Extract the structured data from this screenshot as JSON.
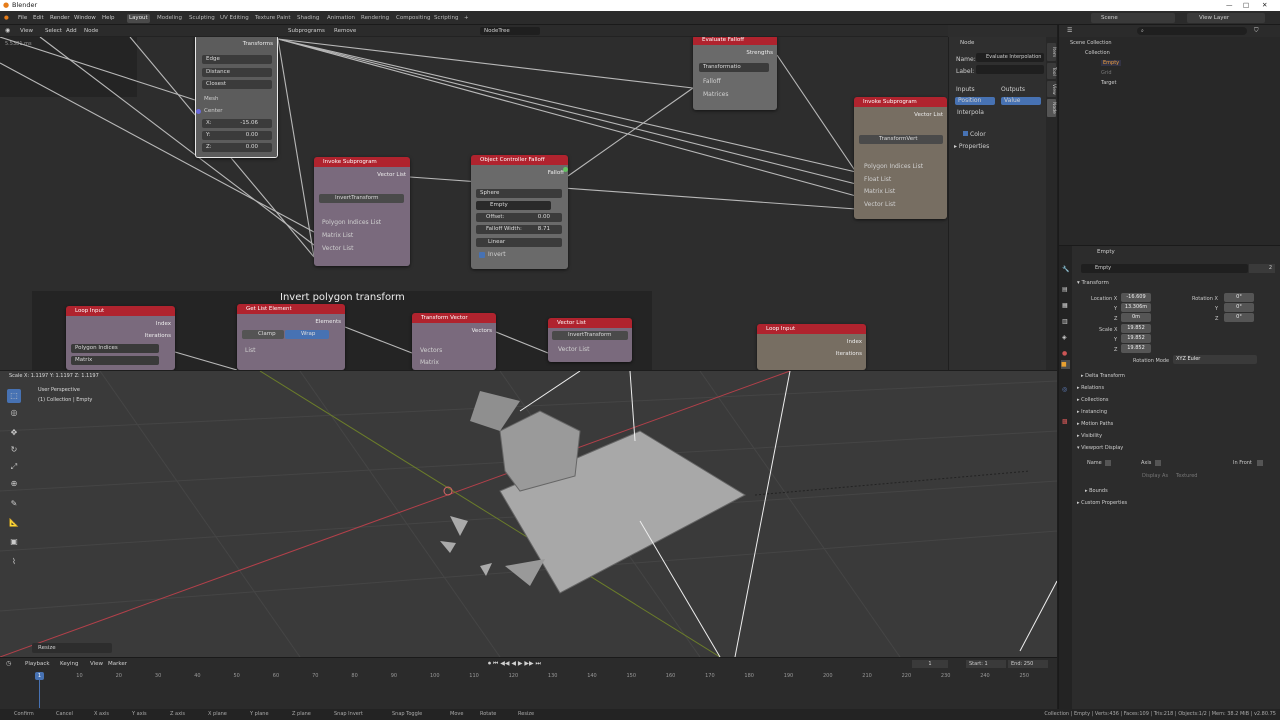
{
  "window": {
    "title": "Blender"
  },
  "topbar": {
    "menus": [
      "File",
      "Edit",
      "Render",
      "Window",
      "Help"
    ],
    "workspaces": [
      "Layout",
      "Modeling",
      "Sculpting",
      "UV Editing",
      "Texture Paint",
      "Shading",
      "Animation",
      "Rendering",
      "Compositing",
      "Scripting"
    ],
    "add_tab": "+",
    "scene": "Scene",
    "view_layer": "View Layer"
  },
  "node_editor": {
    "header_menus": [
      "View",
      "Select",
      "Add",
      "Node"
    ],
    "subprograms": "Subprograms",
    "remove": "Remove",
    "nodetree": "NodeTree",
    "stats": "5.5381 ms",
    "frame_label": "Invert polygon transform",
    "n_transforms": {
      "title": "Transforms",
      "opt1": "Edge",
      "opt2": "Distance",
      "opt3": "Closest",
      "mesh": "Mesh",
      "center": "Center",
      "x_label": "X:",
      "x": "-15.06",
      "y_label": "Y:",
      "y": "0.00",
      "z_label": "Z:",
      "z": "0.00"
    },
    "n_invoke1": {
      "title": "Invoke Subprogram",
      "vector_list": "Vector List",
      "sub": "InvertTransform",
      "in1": "Polygon Indices List",
      "in2": "Matrix List",
      "in3": "Vector List"
    },
    "n_ocf": {
      "title": "Object Controller Falloff",
      "falloff": "Falloff",
      "shape": "Sphere",
      "object": "Empty",
      "offset_label": "Offset:",
      "offset": "0.00",
      "width_label": "Falloff Width:",
      "width": "8.71",
      "interp": "Linear",
      "invert": "Invert"
    },
    "n_evalfalloff": {
      "title": "Evaluate Falloff",
      "strengths": "Strengths",
      "mode": "Transformatio",
      "falloff": "Falloff",
      "matrices": "Matrices"
    },
    "n_invoke2": {
      "title": "Invoke Subprogram",
      "vector_list": "Vector List",
      "sub": "TransformVert",
      "in1": "Polygon Indices List",
      "in2": "Float List",
      "in3": "Matrix List",
      "in4": "Vector List"
    },
    "n_loopinput": {
      "title": "Loop Input",
      "index": "Index",
      "iterations": "Iterations",
      "p1": "Polygon Indices",
      "p2": "Matrix"
    },
    "n_getlist": {
      "title": "Get List Element",
      "elements": "Elements",
      "clamp": "Clamp",
      "wrap": "Wrap",
      "list": "List"
    },
    "n_transformvec": {
      "title": "Transform Vector",
      "vectors": "Vectors",
      "in1": "Vectors",
      "in2": "Matrix"
    },
    "n_vectorlist": {
      "title": "Vector List",
      "sub": "InvertTransform",
      "out": "Vector List"
    },
    "n_loopinput2": {
      "title": "Loop Input",
      "index": "Index",
      "iterations": "Iterations"
    }
  },
  "node_sidebar": {
    "section": "Node",
    "name_label": "Name:",
    "name": "Evaluate Interpolation",
    "label_label": "Label:",
    "inputs": "Inputs",
    "outputs": "Outputs",
    "position": "Position",
    "value": "Value",
    "interp": "Interpola",
    "color": "Color",
    "properties": "Properties",
    "tabs": [
      "Item",
      "Tool",
      "View",
      "Node"
    ]
  },
  "viewport": {
    "scale_readout": "Scale X: 1.1197  Y: 1.1197  Z: 1.1197",
    "perspective": "User Perspective",
    "collection": "(1) Collection | Empty",
    "operator": "Resize"
  },
  "timeline": {
    "menus": [
      "Playback",
      "Keying",
      "View",
      "Marker"
    ],
    "current": "1",
    "start_label": "Start:",
    "start": "1",
    "end_label": "End:",
    "end": "250",
    "ticks": [
      "0",
      "10",
      "20",
      "30",
      "40",
      "50",
      "60",
      "70",
      "80",
      "90",
      "100",
      "110",
      "120",
      "130",
      "140",
      "150",
      "160",
      "170",
      "180",
      "190",
      "200",
      "210",
      "220",
      "230",
      "240",
      "250"
    ]
  },
  "statusbar": {
    "hints": [
      "Confirm",
      "Cancel",
      "X axis",
      "Y axis",
      "Z axis",
      "X plane",
      "Y plane",
      "Z plane",
      "Snap Invert",
      "Snap Toggle",
      "Move",
      "Rotate",
      "Resize"
    ],
    "stats": "Collection | Empty | Verts:436 | Faces:109 | Tris:218 | Objects:1/2 | Mem: 38.2 MiB | v2.80.75"
  },
  "outliner": {
    "items": [
      "Scene Collection",
      "Collection",
      "Empty",
      "Grid",
      "Target"
    ]
  },
  "properties": {
    "object": "Empty",
    "object_field": "Empty",
    "transform": "Transform",
    "loc_label": "Location X",
    "loc_x": "-16.609",
    "loc_y": "13.306m",
    "loc_z": "0m",
    "rot_label": "Rotation X",
    "rot_x": "0°",
    "rot_y": "0°",
    "rot_z": "0°",
    "scale_label": "Scale X",
    "sc_x": "19.852",
    "sc_y": "19.852",
    "sc_z": "19.852",
    "y": "Y",
    "z": "Z",
    "rot_mode_label": "Rotation Mode",
    "rot_mode": "XYZ Euler",
    "sections": [
      "Delta Transform",
      "Relations",
      "Collections",
      "Instancing",
      "Motion Paths",
      "Visibility",
      "Viewport Display"
    ],
    "name_label": "Name",
    "axis_label": "Axis",
    "infront_label": "In Front",
    "displayas_label": "Display As",
    "displayas": "Textured",
    "bounds": "Bounds",
    "custom": "Custom Properties",
    "users": "2"
  },
  "colors": {
    "node_header": "#b0232e",
    "frame": "#242424",
    "selected_outline": "#e8e8e8"
  }
}
